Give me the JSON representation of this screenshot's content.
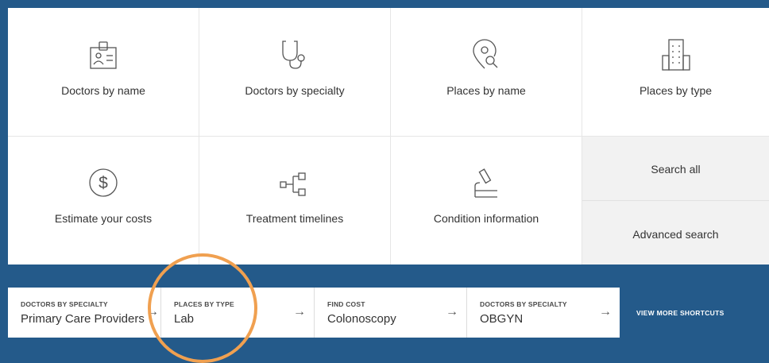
{
  "tiles": {
    "doctors_by_name": "Doctors by name",
    "doctors_by_specialty": "Doctors by specialty",
    "places_by_name": "Places by name",
    "places_by_type": "Places by type",
    "estimate_costs": "Estimate your costs",
    "treatment_timelines": "Treatment timelines",
    "condition_information": "Condition information"
  },
  "side": {
    "search_all": "Search all",
    "advanced_search": "Advanced search"
  },
  "shortcuts": [
    {
      "category": "DOCTORS BY SPECIALTY",
      "value": "Primary Care Providers",
      "arrow": "→"
    },
    {
      "category": "PLACES BY TYPE",
      "value": "Lab",
      "arrow": "→"
    },
    {
      "category": "FIND COST",
      "value": "Colonoscopy",
      "arrow": "→"
    },
    {
      "category": "DOCTORS BY SPECIALTY",
      "value": "OBGYN",
      "arrow": "→"
    }
  ],
  "view_more": "VIEW MORE SHORTCUTS",
  "colors": {
    "background": "#245a8a",
    "highlight_ring": "#f0a050",
    "icon_stroke": "#555555"
  },
  "icons": {
    "doctors_by_name": "id-badge-icon",
    "doctors_by_specialty": "stethoscope-icon",
    "places_by_name": "location-search-icon",
    "places_by_type": "building-icon",
    "estimate_costs": "dollar-circle-icon",
    "treatment_timelines": "flow-tree-icon",
    "condition_information": "microscope-icon"
  }
}
